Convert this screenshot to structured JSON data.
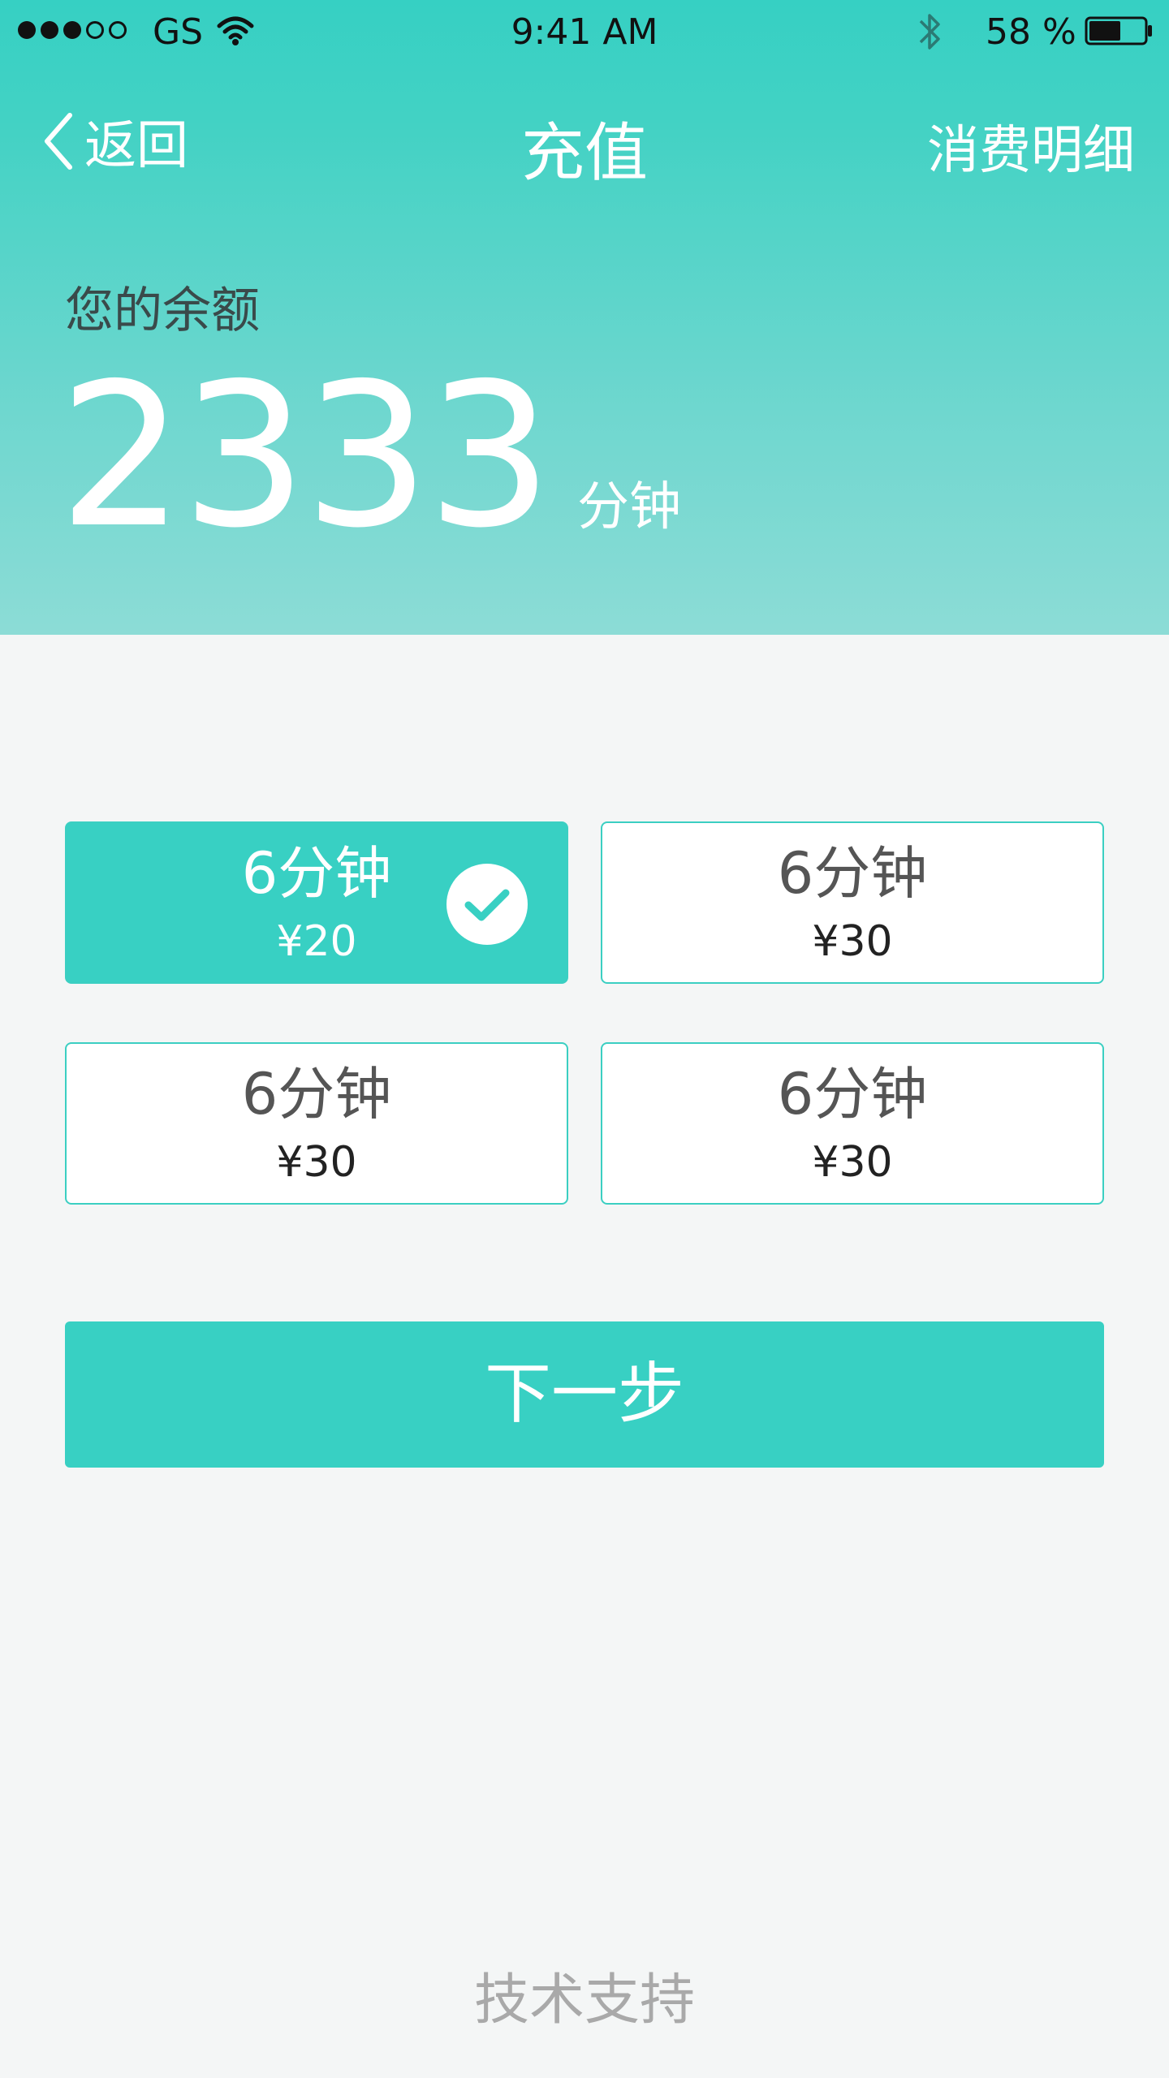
{
  "status_bar": {
    "carrier": "GS",
    "time": "9:41 AM",
    "battery": "58 %",
    "battery_level_percent": 58,
    "signal_bars_filled": 3,
    "signal_bars_total": 5
  },
  "nav": {
    "back_label": "返回",
    "title": "充值",
    "right_label": "消费明细"
  },
  "balance": {
    "label": "您的余额",
    "value": "2333",
    "unit": "分钟"
  },
  "options": [
    {
      "duration": "6分钟",
      "price": "¥20",
      "selected": true
    },
    {
      "duration": "6分钟",
      "price": "¥30",
      "selected": false
    },
    {
      "duration": "6分钟",
      "price": "¥30",
      "selected": false
    },
    {
      "duration": "6分钟",
      "price": "¥30",
      "selected": false
    }
  ],
  "next_button": "下一步",
  "footer": "技术支持",
  "colors": {
    "accent": "#38d0c3",
    "background": "#f4f6f6"
  },
  "icons": {
    "back": "chevron-left-icon",
    "check": "check-circle-icon",
    "wifi": "wifi-icon",
    "bluetooth": "bluetooth-icon",
    "battery": "battery-icon"
  }
}
